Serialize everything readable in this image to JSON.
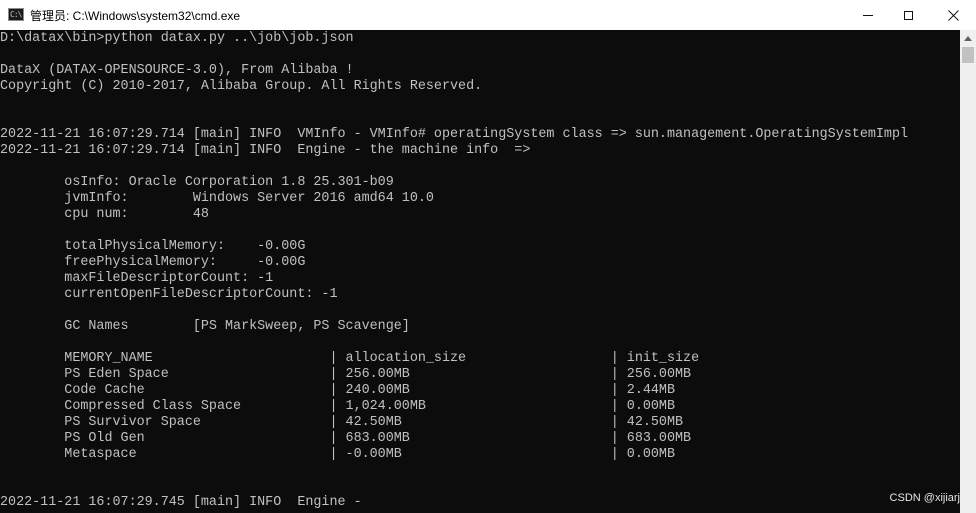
{
  "window": {
    "title": "管理员: C:\\Windows\\system32\\cmd.exe",
    "icon": "cmd-icon",
    "icon_glyph": "C:\\",
    "controls": [
      "minimize",
      "maximize",
      "close"
    ]
  },
  "console": {
    "background": "#0c0c0c",
    "foreground": "#c0c0c0",
    "lines": [
      "D:\\datax\\bin>python datax.py ..\\job\\job.json",
      "",
      "DataX (DATAX-OPENSOURCE-3.0), From Alibaba !",
      "Copyright (C) 2010-2017, Alibaba Group. All Rights Reserved.",
      "",
      "",
      "2022-11-21 16:07:29.714 [main] INFO  VMInfo - VMInfo# operatingSystem class => sun.management.OperatingSystemImpl",
      "2022-11-21 16:07:29.714 [main] INFO  Engine - the machine info  =>",
      "",
      "        osInfo: Oracle Corporation 1.8 25.301-b09",
      "        jvmInfo:        Windows Server 2016 amd64 10.0",
      "        cpu num:        48",
      "",
      "        totalPhysicalMemory:    -0.00G",
      "        freePhysicalMemory:     -0.00G",
      "        maxFileDescriptorCount: -1",
      "        currentOpenFileDescriptorCount: -1",
      "",
      "        GC Names        [PS MarkSweep, PS Scavenge]",
      "",
      "        MEMORY_NAME                      | allocation_size                  | init_size",
      "        PS Eden Space                    | 256.00MB                         | 256.00MB",
      "        Code Cache                       | 240.00MB                         | 2.44MB",
      "        Compressed Class Space           | 1,024.00MB                       | 0.00MB",
      "        PS Survivor Space                | 42.50MB                          | 42.50MB",
      "        PS Old Gen                       | 683.00MB                         | 683.00MB",
      "        Metaspace                        | -0.00MB                          | 0.00MB",
      "",
      "",
      "2022-11-21 16:07:29.745 [main] INFO  Engine -"
    ]
  },
  "watermark": "CSDN @xijiarj"
}
